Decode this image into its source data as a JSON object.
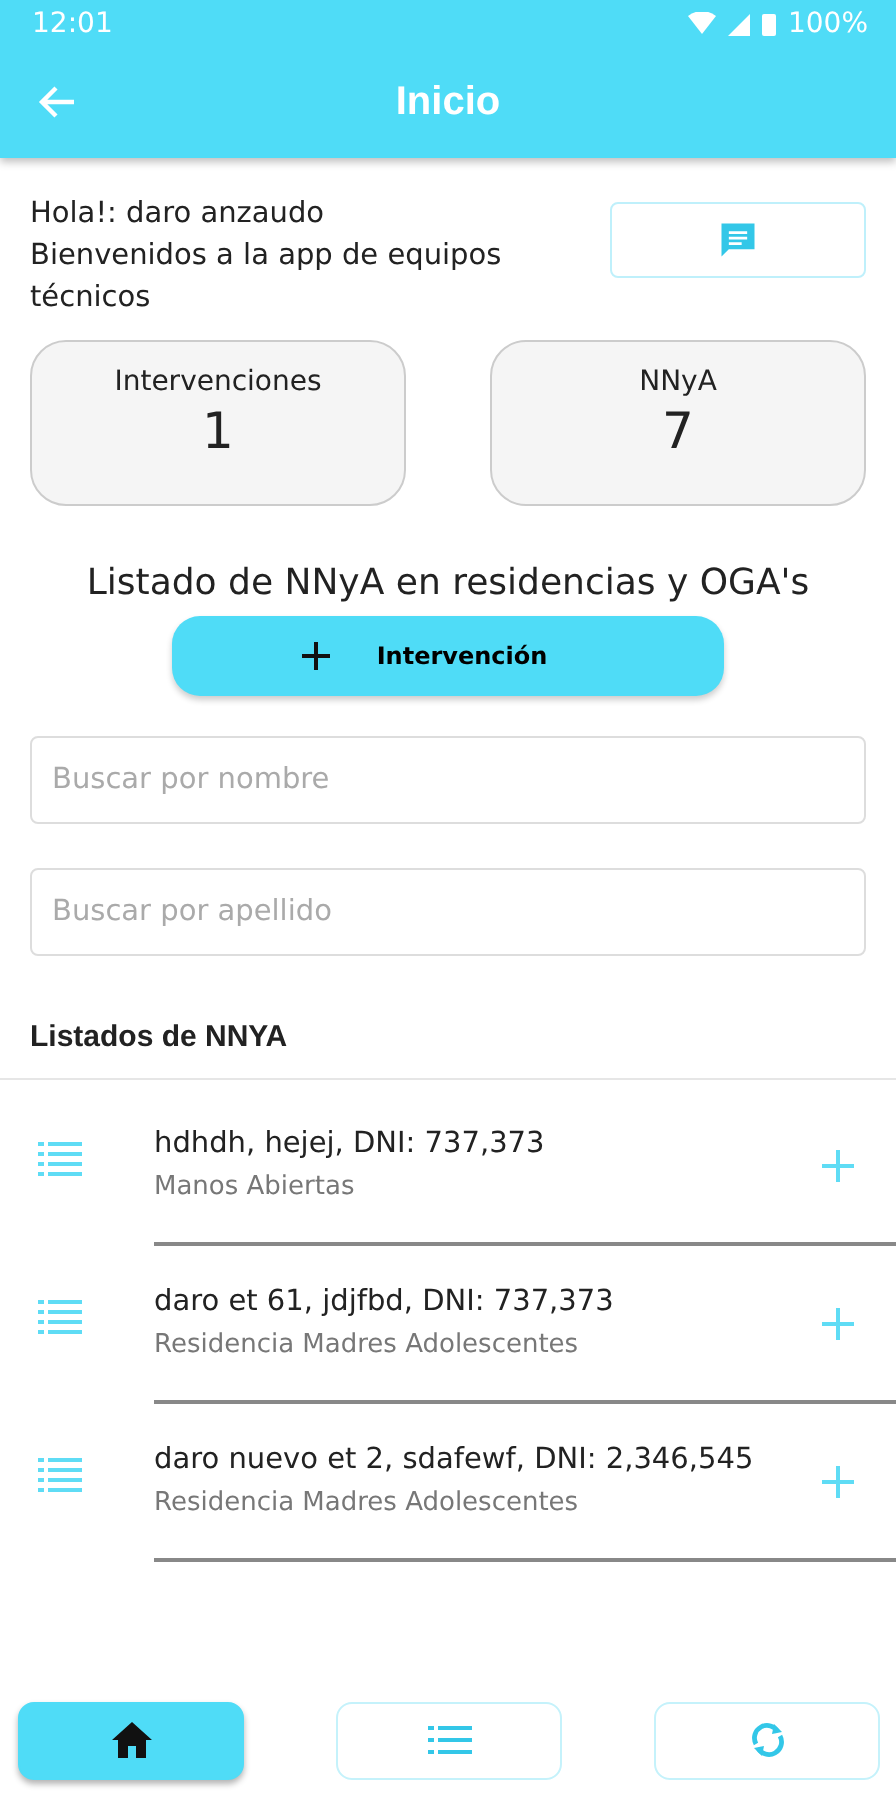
{
  "status_bar": {
    "time": "12:01",
    "battery": "100%"
  },
  "app_bar": {
    "title": "Inicio"
  },
  "greeting": {
    "line_1": "Hola!: daro anzaudo",
    "line_2": "Bienvenidos a la app de equipos técnicos"
  },
  "stats": [
    {
      "label": "Intervenciones",
      "value": "1"
    },
    {
      "label": "NNyA",
      "value": "7"
    }
  ],
  "section_title": "Listado de NNyA en residencias y OGA's",
  "add_button": {
    "label": "Intervención"
  },
  "search_fields": [
    {
      "placeholder": "Buscar por nombre"
    },
    {
      "placeholder": "Buscar por apellido"
    }
  ],
  "list_title": "Listados de NNYA",
  "rows": [
    {
      "title": "hdhdh, hejej, DNI: 737,373",
      "subtitle": "Manos Abiertas"
    },
    {
      "title": "daro et 61, jdjfbd, DNI: 737,373",
      "subtitle": "Residencia Madres Adolescentes"
    },
    {
      "title": "daro nuevo et 2, sdafewf, DNI: 2,346,545",
      "subtitle": "Residencia Madres Adolescentes"
    }
  ],
  "bottom_nav": [
    {
      "kind": "home",
      "selected": true
    },
    {
      "kind": "list",
      "selected": false
    },
    {
      "kind": "sync",
      "selected": false
    }
  ]
}
